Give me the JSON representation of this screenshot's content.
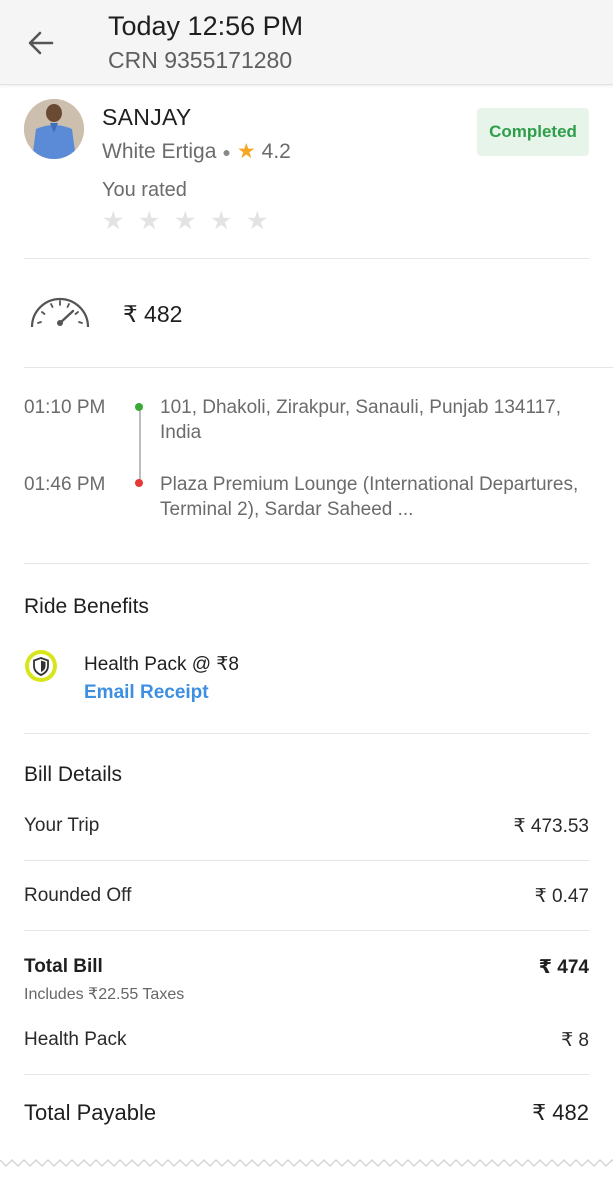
{
  "header": {
    "title": "Today 12:56 PM",
    "crn": "CRN 9355171280",
    "back_icon": "arrow-left-icon"
  },
  "driver": {
    "name": "SANJAY",
    "car": "White Ertiga",
    "rating": "4.2",
    "status": "Completed",
    "you_rated_label": "You rated",
    "user_rating_stars": 0,
    "max_stars": 5
  },
  "fare": {
    "amount": "₹ 482",
    "icon": "speedometer-icon"
  },
  "route": {
    "pickup_time": "01:10 PM",
    "pickup_address": "101, Dhakoli, Zirakpur, Sanauli, Punjab 134117, India",
    "drop_time": "01:46 PM",
    "drop_address": "Plaza Premium Lounge (International Departures, Terminal 2), Sardar Saheed ..."
  },
  "benefits": {
    "title": "Ride Benefits",
    "health_pack": "Health Pack @ ₹8",
    "email_receipt": "Email Receipt",
    "icon": "shield-icon"
  },
  "bill": {
    "title": "Bill Details",
    "your_trip_label": "Your Trip",
    "your_trip_value": "₹ 473.53",
    "rounded_off_label": "Rounded Off",
    "rounded_off_value": "₹ 0.47",
    "total_bill_label": "Total Bill",
    "total_bill_value": "₹ 474",
    "taxes_note": "Includes ₹22.55 Taxes",
    "health_pack_label": "Health Pack",
    "health_pack_value": "₹ 8",
    "total_payable_label": "Total Payable",
    "total_payable_value": "₹ 482"
  },
  "colors": {
    "status_green": "#2e9e4a",
    "status_bg": "#e6f4ea",
    "link_blue": "#3d8fe0",
    "star_orange": "#f5a623",
    "pickup_green": "#3aa935",
    "drop_red": "#e53935",
    "shield_yellow": "#d7e61c"
  }
}
